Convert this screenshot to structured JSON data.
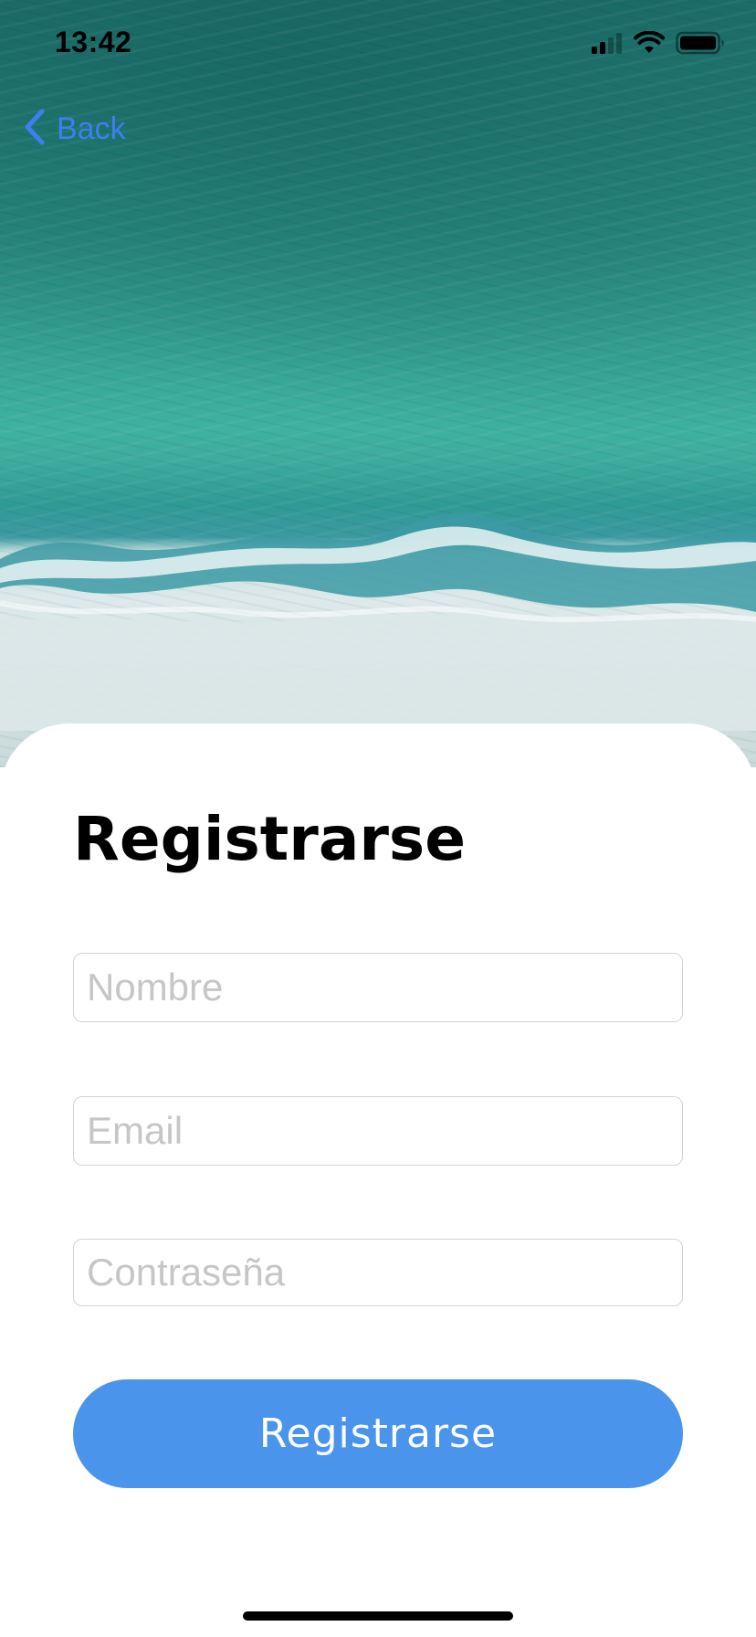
{
  "status_bar": {
    "time": "13:42",
    "signal_icon": "cellular-signal-icon",
    "wifi_icon": "wifi-icon",
    "battery_icon": "battery-icon"
  },
  "nav": {
    "back_label": "Back",
    "back_icon": "chevron-left-icon"
  },
  "hero": {
    "image": "aerial-ocean-waves-photo"
  },
  "form": {
    "title": "Registrarse",
    "name_placeholder": "Nombre",
    "email_placeholder": "Email",
    "password_placeholder": "Contraseña",
    "submit_label": "Registrarse"
  },
  "colors": {
    "accent": "#4a94ec",
    "back_link": "#3c7ff0",
    "placeholder": "#c6c6c6",
    "field_border": "#d3d3d3"
  }
}
